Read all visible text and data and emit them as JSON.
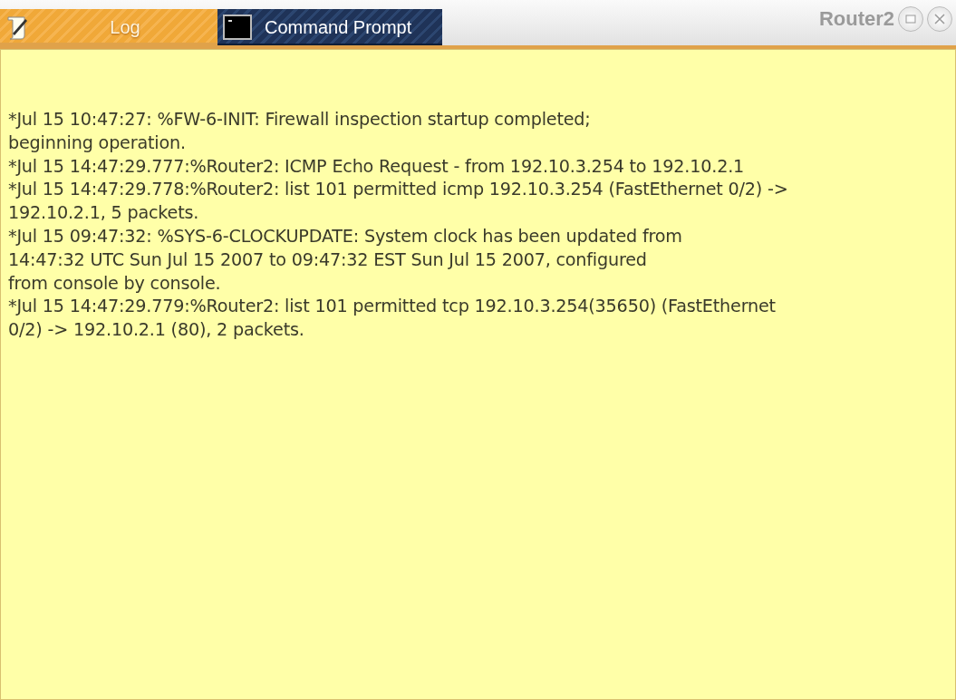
{
  "tabs": [
    {
      "label": "Log",
      "kind": "log",
      "selected": true
    },
    {
      "label": "Command Prompt",
      "kind": "terminal",
      "selected": false
    }
  ],
  "window": {
    "title": "Router2"
  },
  "log_lines": [
    "*Jul 15 10:47:27: %FW-6-INIT: Firewall inspection startup completed;",
    "beginning operation.",
    "*Jul 15 14:47:29.777:%Router2: ICMP Echo Request - from 192.10.3.254 to 192.10.2.1",
    "*Jul 15 14:47:29.778:%Router2: list 101 permitted icmp 192.10.3.254 (FastEthernet 0/2) ->",
    "192.10.2.1, 5 packets.",
    "*Jul 15 09:47:32: %SYS-6-CLOCKUPDATE: System clock has been updated from",
    "14:47:32 UTC Sun Jul 15 2007 to 09:47:32 EST Sun Jul 15 2007, configured",
    "from console by console.",
    "*Jul 15 14:47:29.779:%Router2: list 101 permitted tcp 192.10.3.254(35650) (FastEthernet",
    "0/2) -> 192.10.2.1 (80), 2 packets."
  ]
}
